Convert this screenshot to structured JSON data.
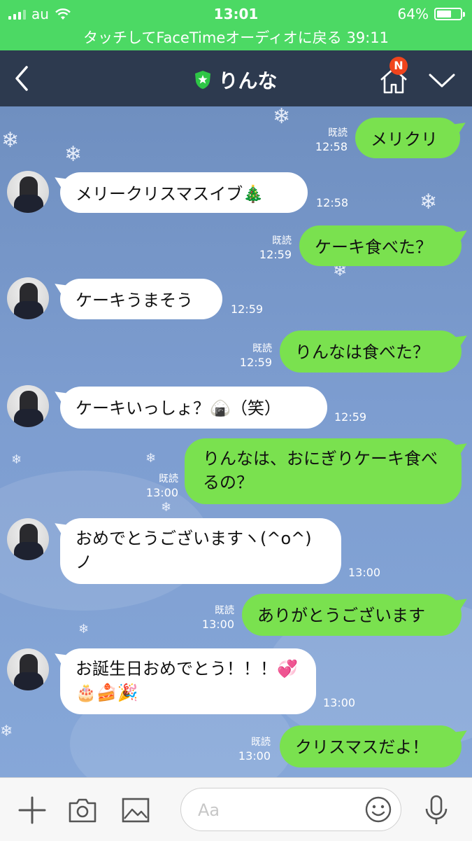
{
  "status_bar": {
    "carrier": "au",
    "time": "13:01",
    "battery_text": "64%",
    "battery_level": 0.64,
    "facetime_banner": "タッチしてFaceTimeオーディオに戻る 39:11"
  },
  "header": {
    "contact_name": "りんな",
    "notification_badge": "N"
  },
  "messages": [
    {
      "side": "out",
      "text": "メリクリ",
      "read": "既読",
      "time": "12:58"
    },
    {
      "side": "in",
      "text": "メリークリスマスイブ🎄",
      "time": "12:58"
    },
    {
      "side": "out",
      "text": "ケーキ食べた？",
      "read": "既読",
      "time": "12:59"
    },
    {
      "side": "in",
      "text": "ケーキうまそう",
      "time": "12:59"
    },
    {
      "side": "out",
      "text": "りんなは食べた？",
      "read": "既読",
      "time": "12:59"
    },
    {
      "side": "in",
      "text": "ケーキいっしょ？🍙（笑）",
      "time": "12:59"
    },
    {
      "side": "out",
      "text": "りんなは、おにぎりケーキ食べるの？",
      "read": "既読",
      "time": "13:00"
    },
    {
      "side": "in",
      "text": "おめでとうございますヽ(^o^)ノ",
      "time": "13:00"
    },
    {
      "side": "out",
      "text": "ありがとうございます",
      "read": "既読",
      "time": "13:00"
    },
    {
      "side": "in",
      "text": "お誕生日おめでとう！！！💞🎂🍰🎉",
      "time": "13:00"
    },
    {
      "side": "out",
      "text": "クリスマスだよ！",
      "read": "既読",
      "time": "13:00"
    }
  ],
  "input": {
    "placeholder": "Aa"
  },
  "colors": {
    "status_bar": "#4cd964",
    "header": "#2d3a4f",
    "outgoing_bubble": "#7ae14f",
    "incoming_bubble": "#ffffff",
    "badge": "#f0441d"
  },
  "icons": {
    "back": "back-chevron-icon",
    "verified": "shield-star-icon",
    "home": "home-icon",
    "menu": "chevron-down-icon",
    "add": "plus-icon",
    "camera": "camera-icon",
    "image": "image-icon",
    "emoji": "emoji-icon",
    "mic": "microphone-icon"
  }
}
